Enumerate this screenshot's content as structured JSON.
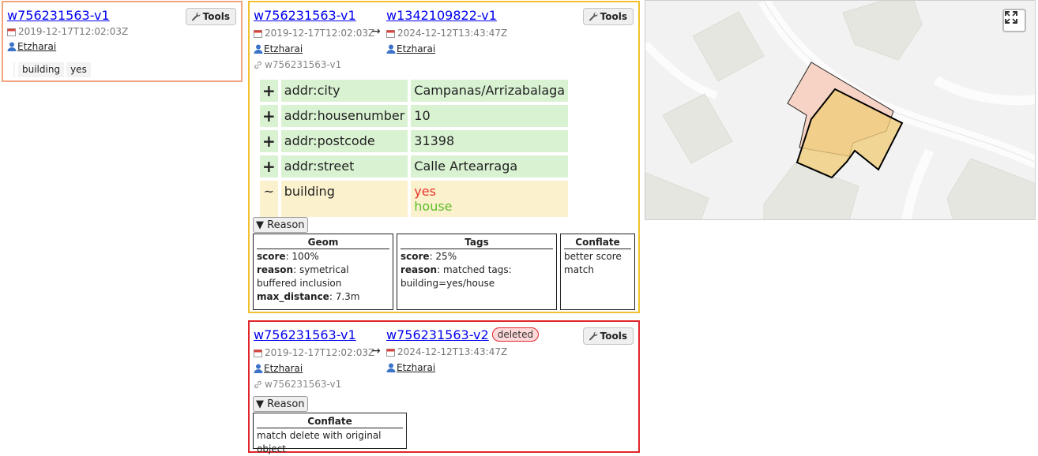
{
  "left_card": {
    "object_link": "w756231563-v1",
    "timestamp": "2019-12-17T12:02:03Z",
    "user": "Etzharai",
    "tags": [
      {
        "key": "building",
        "value": "yes"
      }
    ],
    "tools_label": "Tools",
    "border_color": "#f2a47f"
  },
  "mid_card": {
    "old": {
      "object_link": "w756231563-v1",
      "timestamp": "2019-12-17T12:02:03Z",
      "user": "Etzharai"
    },
    "new": {
      "object_link": "w1342109822-v1",
      "timestamp": "2024-12-12T13:43:47Z",
      "user": "Etzharai"
    },
    "arrow": "→",
    "ref": "w756231563-v1",
    "tools_label": "Tools",
    "diff": [
      {
        "sym": "+",
        "key": "addr:city",
        "value": "Campanas/Arrizabalaga"
      },
      {
        "sym": "+",
        "key": "addr:housenumber",
        "value": "10"
      },
      {
        "sym": "+",
        "key": "addr:postcode",
        "value": "31398"
      },
      {
        "sym": "+",
        "key": "addr:street",
        "value": "Calle Artearraga"
      },
      {
        "sym": "~",
        "key": "building",
        "old_value": "yes",
        "new_value": "house"
      }
    ],
    "reason_label": "▼ Reason",
    "reasons": {
      "geom": {
        "title": "Geom",
        "score_label": "score",
        "score": "100%",
        "reason_label": "reason",
        "reason": "symetrical buffered inclusion",
        "max_distance_label": "max_distance",
        "max_distance": "7.3m"
      },
      "tags": {
        "title": "Tags",
        "score_label": "score",
        "score": "25%",
        "reason_label": "reason",
        "reason": "matched tags: building=yes/house"
      },
      "conflate": {
        "title": "Conflate",
        "text": "better score match"
      }
    },
    "border_color": "#f0c12c"
  },
  "del_card": {
    "old": {
      "object_link": "w756231563-v1",
      "timestamp": "2019-12-17T12:02:03Z",
      "user": "Etzharai"
    },
    "new": {
      "object_link": "w756231563-v2",
      "timestamp": "2024-12-12T13:43:47Z",
      "user": "Etzharai",
      "badge": "deleted"
    },
    "arrow": "→",
    "ref": "w756231563-v1",
    "tools_label": "Tools",
    "reason_label": "▼ Reason",
    "conflate": {
      "title": "Conflate",
      "text": "match delete with original object"
    },
    "border_color": "#e0262a"
  },
  "map": {
    "fullscreen_icon": "expand-icon",
    "old_polygon_color": "#f6d1c1",
    "new_polygon_color": "#f0cd7c"
  },
  "icons": {
    "calendar": "calendar-icon",
    "user": "user-icon",
    "link": "link-icon",
    "wrench": "wrench-icon"
  }
}
